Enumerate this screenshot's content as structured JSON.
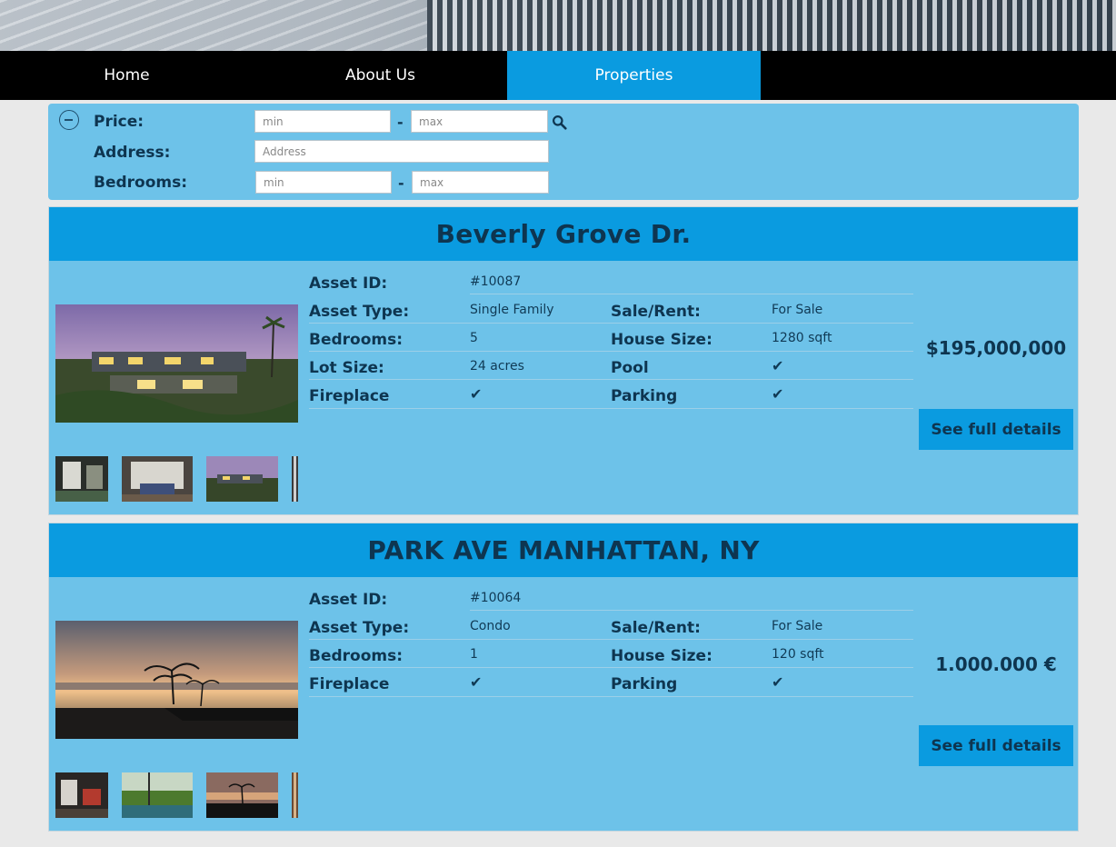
{
  "nav": {
    "items": [
      {
        "label": "Home",
        "active": false
      },
      {
        "label": "About Us",
        "active": false
      },
      {
        "label": "Properties",
        "active": true
      }
    ]
  },
  "search": {
    "price_label": "Price:",
    "address_label": "Address:",
    "bedrooms_label": "Bedrooms:",
    "price_min_placeholder": "min",
    "price_max_placeholder": "max",
    "address_placeholder": "Address",
    "bedrooms_min_placeholder": "min",
    "bedrooms_max_placeholder": "max",
    "dash": "-",
    "icons": [
      "collapse-icon",
      "search-icon"
    ]
  },
  "listings": [
    {
      "title": "Beverly Grove Dr.",
      "asset_id_label": "Asset ID:",
      "asset_id": "#10087",
      "asset_type_label": "Asset Type:",
      "asset_type": "Single Family",
      "sale_rent_label": "Sale/Rent:",
      "sale_rent": "For Sale",
      "bedrooms_label": "Bedrooms:",
      "bedrooms": "5",
      "house_size_label": "House Size:",
      "house_size": "1280 sqft",
      "lot_size_label": "Lot Size:",
      "lot_size": "24 acres",
      "pool_label": "Pool",
      "fireplace_label": "Fireplace",
      "parking_label": "Parking",
      "check": "✔",
      "price": "$195,000,000",
      "details_label": "See full details"
    },
    {
      "title": "PARK AVE MANHATTAN, NY",
      "asset_id_label": "Asset ID:",
      "asset_id": "#10064",
      "asset_type_label": "Asset Type:",
      "asset_type": "Condo",
      "sale_rent_label": "Sale/Rent:",
      "sale_rent": "For Sale",
      "bedrooms_label": "Bedrooms:",
      "bedrooms": "1",
      "house_size_label": "House Size:",
      "house_size": "120 sqft",
      "fireplace_label": "Fireplace",
      "parking_label": "Parking",
      "check": "✔",
      "price": "1.000.000 €",
      "details_label": "See full details"
    }
  ]
}
